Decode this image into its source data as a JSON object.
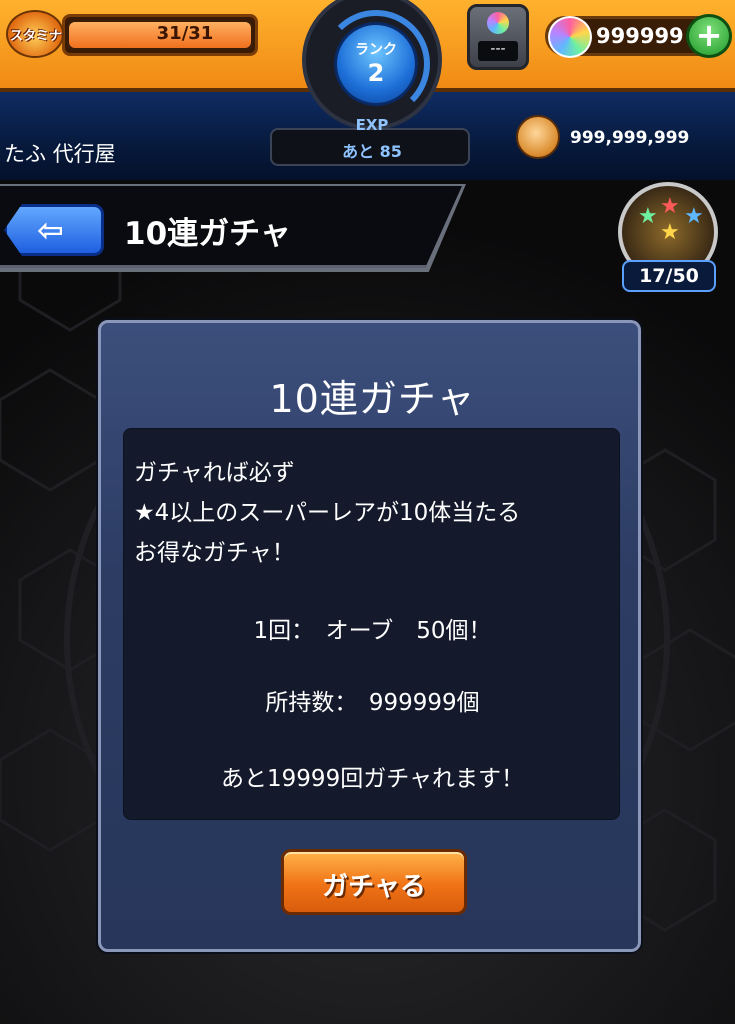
{
  "header": {
    "stamina_label": "スタミナ",
    "stamina_value": "31/31",
    "stamina_fraction": 1.0,
    "rank_label": "ランク",
    "rank_value": "2",
    "exp_label": "EXP",
    "exp_remaining": "あと 85",
    "device_text": "---",
    "orbs": "999999",
    "player_name": "たふ 代行屋",
    "coins": "999,999,999"
  },
  "screen": {
    "title": "10連ガチャ",
    "medal_count": "17/50"
  },
  "dialog": {
    "title": "10連ガチャ",
    "description": [
      "ガチャれば必ず",
      "★4以上のスーパーレアが10体当たる",
      "お得なガチャ！"
    ],
    "cost": "1回：　オーブ　50個！",
    "owned": "所持数：　999999個",
    "remaining": "あと19999回ガチャれます！",
    "button_label": "ガチャる"
  },
  "colors": {
    "topbar": "#f59a1c",
    "subbar": "#0a1f4a",
    "dialog": "#2f4068",
    "button": "#f07316",
    "back_button": "#2f74f0"
  },
  "icons": {
    "stamina": "stamina-fire-icon",
    "back": "back-arrow-icon",
    "orb": "rainbow-orb-icon",
    "coin": "gold-coin-icon",
    "plus": "plus-icon",
    "medal": "star-medal-icon",
    "device": "gacha-device-icon"
  }
}
